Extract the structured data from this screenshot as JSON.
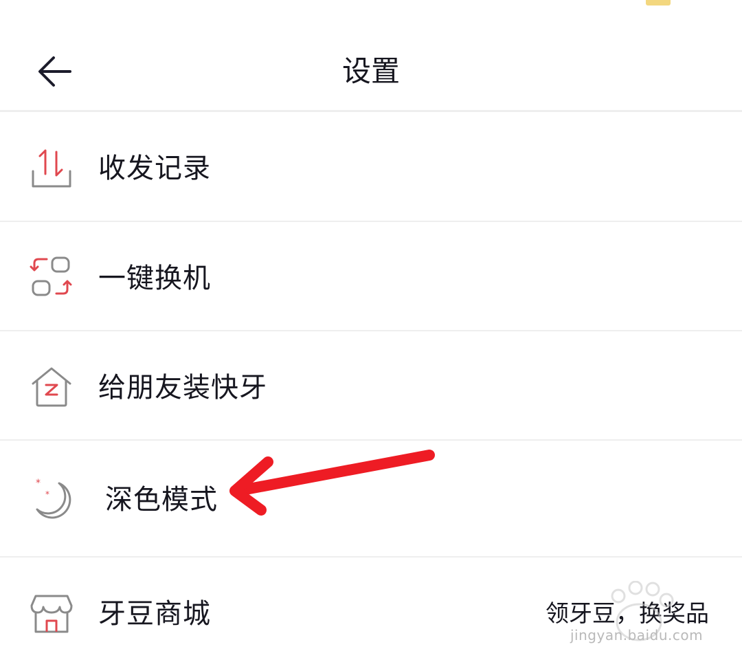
{
  "header": {
    "title": "设置",
    "back_icon": "arrow-left-icon"
  },
  "menu": [
    {
      "label": "收发记录",
      "icon": "transfer-record-icon",
      "right_text": ""
    },
    {
      "label": "一键换机",
      "icon": "phone-switch-icon",
      "right_text": ""
    },
    {
      "label": "给朋友装快牙",
      "icon": "house-z-icon",
      "right_text": ""
    },
    {
      "label": "深色模式",
      "icon": "moon-icon",
      "right_text": ""
    },
    {
      "label": "牙豆商城",
      "icon": "store-icon",
      "right_text": "领牙豆，换奖品"
    }
  ],
  "watermark": {
    "text": "jingyan.baidu.com"
  },
  "colors": {
    "accent_red": "#e0484f",
    "icon_gray": "#8a8a8a",
    "arrow_red": "#ee1c24",
    "divider": "#eeeeee"
  }
}
